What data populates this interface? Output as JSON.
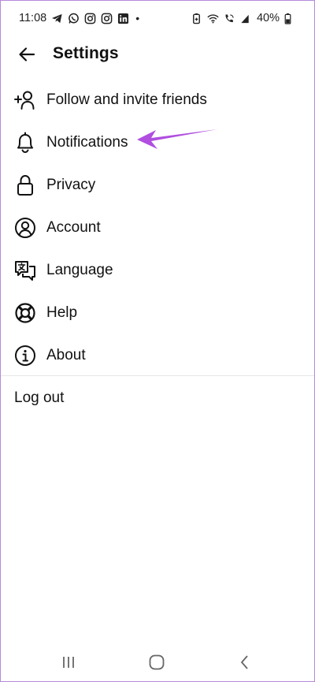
{
  "status_bar": {
    "time": "11:08",
    "dot": "•",
    "battery": "40%",
    "icons": [
      "telegram-icon",
      "whatsapp-icon",
      "instagram-icon",
      "instagram-icon",
      "linkedin-icon",
      "battery-saver-icon",
      "wifi-icon",
      "wifi-calling-icon",
      "signal-icon",
      "battery-icon"
    ]
  },
  "header": {
    "title": "Settings",
    "back_icon": "arrow-left-icon"
  },
  "menu": {
    "items": [
      {
        "label": "Follow and invite friends",
        "icon": "add-person-icon"
      },
      {
        "label": "Notifications",
        "icon": "bell-icon"
      },
      {
        "label": "Privacy",
        "icon": "lock-icon"
      },
      {
        "label": "Account",
        "icon": "account-circle-icon"
      },
      {
        "label": "Language",
        "icon": "translate-icon"
      },
      {
        "label": "Help",
        "icon": "lifebuoy-icon"
      },
      {
        "label": "About",
        "icon": "info-icon"
      }
    ],
    "logout_label": "Log out"
  },
  "annotation": {
    "color": "#b04fe0",
    "target": "Notifications"
  },
  "nav_bar": {
    "icons": [
      "recents-icon",
      "home-icon",
      "back-icon"
    ]
  }
}
